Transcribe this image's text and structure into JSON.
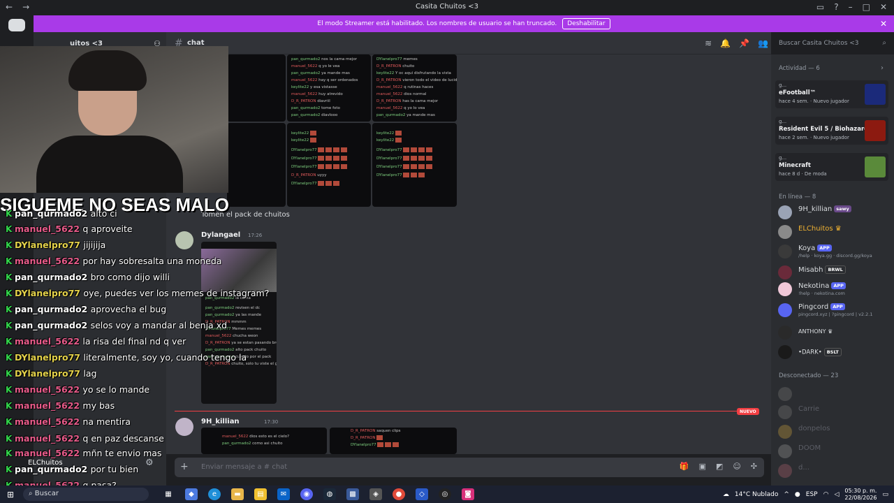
{
  "window": {
    "title": "Casita Chuitos <3",
    "nav_back": "←",
    "nav_fwd": "→"
  },
  "banner": {
    "text": "El modo Streamer está habilitado. Los nombres de usuario se han truncado.",
    "button": "Deshabilitar"
  },
  "server": {
    "name": "uitos <3"
  },
  "channel": {
    "name": "chat"
  },
  "search": {
    "placeholder": "Buscar Casita Chuitos <3"
  },
  "messages": {
    "caption1": "Tomen el pack de chuitos",
    "msg2_author": "Dylangael",
    "msg2_time": "17:26",
    "msg3_author": "9H_killian",
    "msg3_time": "17:30",
    "new_label": "NUEVO"
  },
  "composer": {
    "placeholder": "Enviar mensaje a #",
    "channel": "chat"
  },
  "activity": {
    "header": "Actividad — 6",
    "cards": [
      {
        "user": "g...",
        "game": "eFootball™",
        "meta": "hace 4 sem.",
        "badge": "Nuevo jugador",
        "color": "#1b2a7a"
      },
      {
        "user": "g...",
        "game": "Resident Evil 5 / Biohazard 5",
        "meta": "hace 2 sem.",
        "badge": "Nuevo jugador",
        "color": "#8c1a10"
      },
      {
        "user": "g...",
        "game": "Minecraft",
        "meta": "hace 8 d",
        "badge": "De moda",
        "color": "#5a8a3a"
      }
    ]
  },
  "online": {
    "header": "En línea — 8",
    "members": [
      {
        "name": "9H_killian",
        "tag": "sawy",
        "sub": "",
        "color": "#9aa3b5",
        "name_color": "#dbdee1"
      },
      {
        "name": "ELChuitos",
        "tag": "",
        "sub": "",
        "color": "#8a8a8a",
        "name_color": "#f0b232"
      },
      {
        "name": "Koya",
        "tag": "APP",
        "sub": "/help · koya.gg · discord.gg/koya",
        "color": "#3a3a3a",
        "name_color": "#dbdee1"
      },
      {
        "name": "Misabh",
        "tag": "BRWL",
        "sub": "",
        "color": "#6a2a3a",
        "name_color": "#dbdee1"
      },
      {
        "name": "Nekotina",
        "tag": "APP",
        "sub": "!help · nekotina.com",
        "color": "#f0c8d8",
        "name_color": "#dbdee1"
      },
      {
        "name": "Pingcord",
        "tag": "APP",
        "sub": "pingcord.xyz | ?pingcord | v2.2.1",
        "color": "#5865f2",
        "name_color": "#dbdee1"
      },
      {
        "name": "ANTHONY",
        "tag": "",
        "sub": "",
        "color": "#2a2a2a",
        "name_color": "#dbdee1"
      },
      {
        "name": "•DARK•",
        "tag": "BSLT",
        "sub": "",
        "color": "#1a1a1a",
        "name_color": "#dbdee1"
      }
    ]
  },
  "offline": {
    "header": "Desconectado — 23",
    "members": [
      "",
      "Carrie",
      "donpelos",
      "DOOM",
      "d..."
    ]
  },
  "overlay": {
    "banner_text": "SIGUEME NO SEAS MALO",
    "lines": [
      {
        "name": "pan_qurmado2",
        "color": "w",
        "text": "alto ci"
      },
      {
        "name": "manuel_5622",
        "color": "r",
        "text": "q aproveite"
      },
      {
        "name": "DYlanelpro77",
        "color": "y",
        "text": "jijijija"
      },
      {
        "name": "manuel_5622",
        "color": "r",
        "text": "por hay sobresalta una moneda"
      },
      {
        "name": "pan_qurmado2",
        "color": "w",
        "text": "bro como dijo willi"
      },
      {
        "name": "DYlanelpro77",
        "color": "y",
        "text": "oye, puedes ver los memes de instagram?"
      },
      {
        "name": "pan_qurmado2",
        "color": "w",
        "text": "aprovecha el bug"
      },
      {
        "name": "pan_qurmado2",
        "color": "w",
        "text": "selos voy a mandar al benja xd"
      },
      {
        "name": "manuel_5622",
        "color": "r",
        "text": "la risa del final nd q ver"
      },
      {
        "name": "DYlanelpro77",
        "color": "y",
        "text": "literalmente, soy yo, cuando tengo la"
      },
      {
        "name": "DYlanelpro77",
        "color": "y",
        "text": "lag"
      },
      {
        "name": "manuel_5622",
        "color": "r",
        "text": "yo se lo mande"
      },
      {
        "name": "manuel_5622",
        "color": "r",
        "text": "my bas"
      },
      {
        "name": "manuel_5622",
        "color": "r",
        "text": "na mentira"
      },
      {
        "name": "manuel_5622",
        "color": "r",
        "text": "q en paz descanse"
      },
      {
        "name": "manuel_5622",
        "color": "r",
        "text": "mñn te envio mas"
      },
      {
        "name": "pan_qurmado2",
        "color": "w",
        "text": "por tu bien"
      },
      {
        "name": "manuel_5622",
        "color": "r",
        "text": "q pasa?"
      }
    ]
  },
  "user_panel": {
    "name": "ELChuitos"
  },
  "taskbar": {
    "search": "Buscar",
    "weather": "14°C  Nublado",
    "lang": "ESP",
    "time": "05:30 p. m.",
    "date": "22/08/2026"
  }
}
